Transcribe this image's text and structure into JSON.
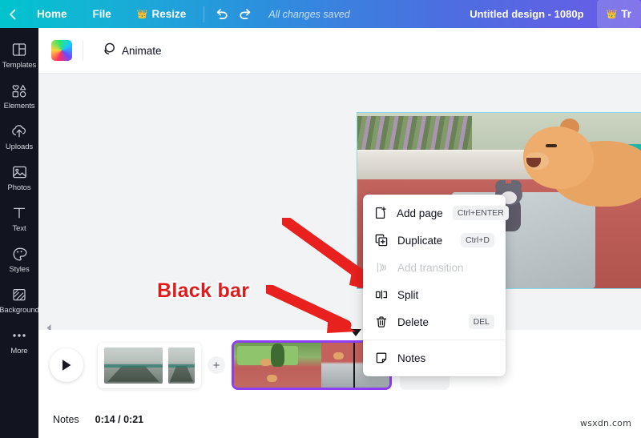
{
  "topbar": {
    "back_icon": "chevron-left-icon",
    "home": "Home",
    "file": "File",
    "resize": "Resize",
    "resize_icon": "crown-icon",
    "undo_icon": "undo-icon",
    "redo_icon": "redo-icon",
    "status": "All changes saved",
    "title": "Untitled design - 1080p",
    "try_label": "Tr",
    "try_icon": "crown-icon",
    "gradient_start": "#00c4cc",
    "gradient_end": "#6a5be6"
  },
  "sidebar": {
    "items": [
      {
        "label": "Templates",
        "icon": "templates-icon"
      },
      {
        "label": "Elements",
        "icon": "elements-icon"
      },
      {
        "label": "Uploads",
        "icon": "uploads-icon"
      },
      {
        "label": "Photos",
        "icon": "photos-icon"
      },
      {
        "label": "Text",
        "icon": "text-icon"
      },
      {
        "label": "Styles",
        "icon": "styles-icon"
      },
      {
        "label": "Background",
        "icon": "background-icon"
      },
      {
        "label": "More",
        "icon": "more-icon"
      }
    ],
    "background_color": "#12141f"
  },
  "toolbar2": {
    "color_swatch": "rainbow-gradient-swatch",
    "animate_label": "Animate",
    "animate_icon": "animate-icon"
  },
  "canvas": {
    "scroll_left_icon": "caret-left-icon",
    "page_border_color": "#86d9e6",
    "scene_description": "3D cartoon animals on a balcony"
  },
  "annotation": {
    "text": "Black bar",
    "color": "#e01b1b",
    "arrows": 2
  },
  "context_menu": {
    "items": [
      {
        "label": "Add page",
        "shortcut": "Ctrl+ENTER",
        "icon": "add-page-icon",
        "disabled": false
      },
      {
        "label": "Duplicate",
        "shortcut": "Ctrl+D",
        "icon": "duplicate-icon",
        "disabled": false
      },
      {
        "label": "Add transition",
        "shortcut": "",
        "icon": "transition-icon",
        "disabled": true
      },
      {
        "label": "Split",
        "shortcut": "",
        "icon": "split-icon",
        "disabled": false
      },
      {
        "label": "Delete",
        "shortcut": "DEL",
        "icon": "trash-icon",
        "disabled": false
      },
      {
        "label": "Notes",
        "shortcut": "",
        "icon": "notes-icon",
        "disabled": false
      }
    ]
  },
  "timeline": {
    "play_icon": "play-icon",
    "add_clip_label": "+",
    "selected_clip_border": "#8b3ff0",
    "playhead_marker": "playhead-triangle"
  },
  "footer": {
    "notes_label": "Notes",
    "time": "0:14 / 0:21"
  },
  "watermark": "wsxdn.com"
}
